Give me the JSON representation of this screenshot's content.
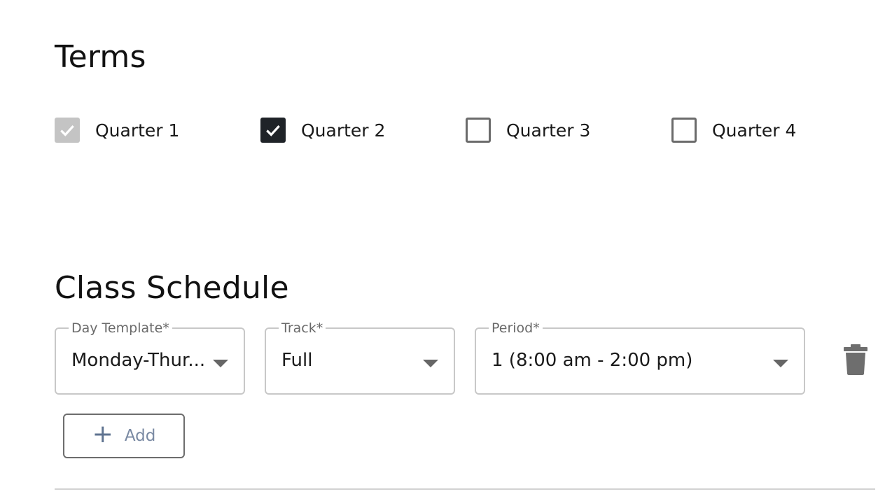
{
  "terms": {
    "title": "Terms",
    "items": [
      {
        "label": "Quarter 1",
        "state": "checked-disabled"
      },
      {
        "label": "Quarter 2",
        "state": "checked"
      },
      {
        "label": "Quarter 3",
        "state": "unchecked"
      },
      {
        "label": "Quarter 4",
        "state": "unchecked"
      }
    ]
  },
  "schedule": {
    "title": "Class Schedule",
    "day_template": {
      "label": "Day Template*",
      "value": "Monday-Thur..."
    },
    "track": {
      "label": "Track*",
      "value": "Full"
    },
    "period": {
      "label": "Period*",
      "value": "1 (8:00 am - 2:00 pm)"
    },
    "delete_icon": "trash-icon",
    "add_button": {
      "label": "Add",
      "icon": "plus-icon"
    }
  },
  "colors": {
    "checked": "#1f2328",
    "checked_disabled": "#c4c4c4",
    "border": "#c8c8c8",
    "add_text": "#7a8aa3"
  }
}
